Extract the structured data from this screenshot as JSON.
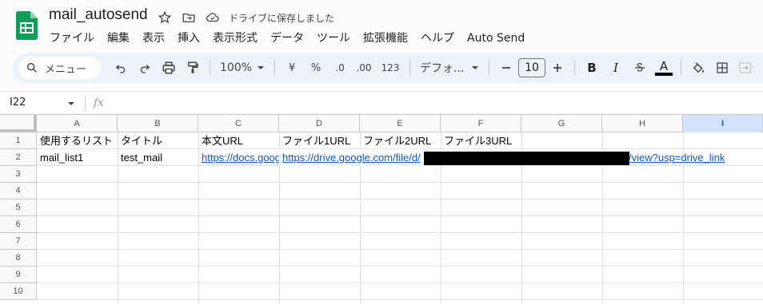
{
  "app": {
    "title": "mail_autosend",
    "save_status": "ドライブに保存しました"
  },
  "menu": [
    "ファイル",
    "編集",
    "表示",
    "挿入",
    "表示形式",
    "データ",
    "ツール",
    "拡張機能",
    "ヘルプ",
    "Auto Send"
  ],
  "toolbar": {
    "search_label": "メニュー",
    "zoom": "100%",
    "currency": "¥",
    "percent": "%",
    "decrease_decimal": ".0",
    "increase_decimal": ".00",
    "number_format": "123",
    "font": "デフォ...",
    "font_size": "10",
    "bold": "B",
    "italic": "I",
    "text_color_label": "A"
  },
  "formula_bar": {
    "name_box": "I22",
    "fx": "fx"
  },
  "columns": [
    "A",
    "B",
    "C",
    "D",
    "E",
    "F",
    "G",
    "H",
    "I"
  ],
  "rows": [
    "1",
    "2",
    "3",
    "4",
    "5",
    "6",
    "7",
    "8",
    "9",
    "10"
  ],
  "cells": {
    "A1": "使用するリスト",
    "B1": "タイトル",
    "C1": "本文URL",
    "D1": "ファイル1URL",
    "E1": "ファイル2URL",
    "F1": "ファイル3URL",
    "A2": "mail_list1",
    "B2": "test_mail",
    "C2": "https://docs.goog",
    "D2": "https://drive.google.com/file/d/",
    "D2_tail": "/view?usp=drive_link"
  },
  "colors": {
    "selected_col_bg": "#d3e3fd",
    "link": "#1155cc",
    "sheets_green": "#0f9d58"
  }
}
